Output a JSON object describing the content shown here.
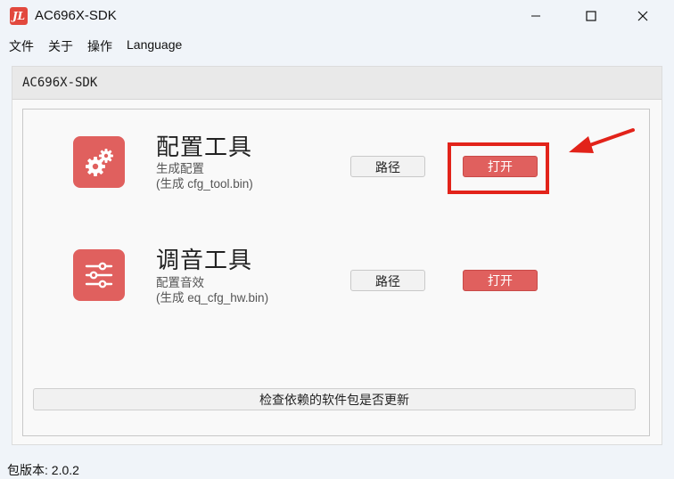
{
  "window": {
    "title": "AC696X-SDK",
    "icon_glyph": "JL"
  },
  "menu": {
    "items": [
      "文件",
      "关于",
      "操作",
      "Language"
    ]
  },
  "panel": {
    "header": "AC696X-SDK"
  },
  "tools": [
    {
      "title": "配置工具",
      "desc1": "生成配置",
      "desc2": "(生成 cfg_tool.bin)",
      "path_label": "路径",
      "open_label": "打开",
      "icon": "gears-icon"
    },
    {
      "title": "调音工具",
      "desc1": "配置音效",
      "desc2": "(生成 eq_cfg_hw.bin)",
      "path_label": "路径",
      "open_label": "打开",
      "icon": "sliders-icon"
    }
  ],
  "update_button": "检查依赖的软件包是否更新",
  "status": {
    "version": "包版本:  2.0.2"
  },
  "colors": {
    "accent": "#e0605e",
    "annotation": "#e2231a"
  }
}
